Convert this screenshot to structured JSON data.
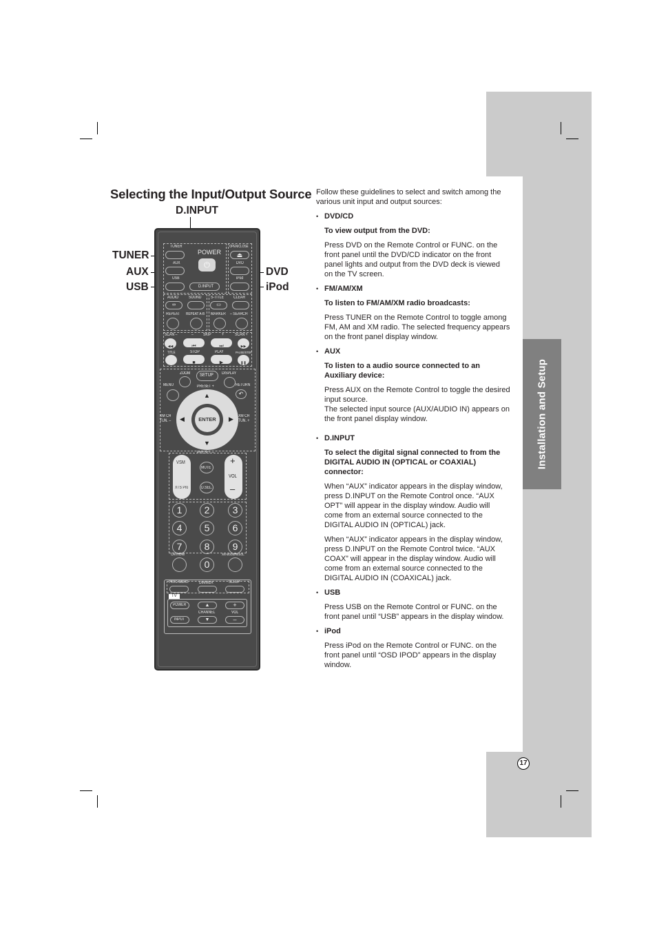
{
  "page": {
    "title": "Selecting the Input/Output Source",
    "side_tab": "Installation and Setup",
    "page_number": "17"
  },
  "callouts": {
    "dinput": "D.INPUT",
    "tuner": "TUNER",
    "aux": "AUX",
    "usb": "USB",
    "dvd": "DVD",
    "ipod": "iPod"
  },
  "remote": {
    "top": {
      "tuner": "TUNER",
      "aux": "AUX",
      "usb": "USB",
      "power": "POWER",
      "power_icon": "⏻",
      "dinput": "D.INPUT",
      "open_close": "OPEN/CLOSE",
      "eject_icon": "⏏",
      "dvd": "DVD",
      "ipod": "iPod"
    },
    "row2": {
      "audio": "AUDIO",
      "sound": "SOUND",
      "stitle": "S-TITLE",
      "clear": "CLEAR",
      "repeat": "REPEAT",
      "repeat_ab": "REPEAT A-B",
      "marker": "MARKER",
      "search": "– SEARCH"
    },
    "transport": {
      "scan_minus": "SCAN –",
      "skip_minus": "–",
      "skip": "SKIP",
      "skip_plus": "+",
      "scan_plus": "SCAN +",
      "rew_icon": "◀◀",
      "prev_icon": "⏮",
      "next_icon": "⏭",
      "ff_icon": "▶▶",
      "title": "TITLE",
      "stop": "STOP",
      "play": "PLAY",
      "pause": "PAUSE/STEP",
      "stop_icon": "■",
      "play_icon": "▶",
      "pause_icon": "❚❚"
    },
    "nav": {
      "zoom": "ZOOM",
      "setup": "SETUP",
      "display": "DISPLAY",
      "menu": "MENU",
      "return": "RETURN",
      "preset_plus": "PRESET +",
      "preset_minus": "PRESET –",
      "xm_left": "XM CH\nTUN. –",
      "xm_right": "XM CH\nTUN. +",
      "enter": "ENTER",
      "up": "▲",
      "down": "▼",
      "left": "◀",
      "right": "▶",
      "return_icon": "↶"
    },
    "volume": {
      "vsm": "VSM",
      "xts": "XTS Pro",
      "mute": "MUTE",
      "dsel": "D.SEL.",
      "plus": "+",
      "vol": "VOL",
      "minus": "–"
    },
    "numbers": [
      "1",
      "2",
      "3",
      "4",
      "5",
      "6",
      "7",
      "8",
      "9",
      "0"
    ],
    "num_labels": {
      "cat_hdmi": "CAT/HDMI",
      "xm_mode": "XM MODE/RESOL."
    },
    "bottom": {
      "prog_memo": "PROG./MEMO.",
      "dimmer": "DIMMER",
      "sleep": "SLEEP",
      "tv": "TV",
      "tv_power": "POWER",
      "tv_input": "INPUT",
      "channel": "CHANNEL",
      "vol": "VOL",
      "ch_up": "▲",
      "ch_down": "▼",
      "vol_plus": "+",
      "vol_minus": "–"
    }
  },
  "content": {
    "intro": "Follow these guidelines to select and switch among the various unit input and output sources:",
    "sections": [
      {
        "bullet": "DVD/CD",
        "subhead": "To view output from the DVD:",
        "paragraphs": [
          "Press DVD on the Remote Control or FUNC. on the front panel until the DVD/CD indicator on the front panel lights and output from the DVD deck is viewed on the TV screen."
        ]
      },
      {
        "bullet": "FM/AM/XM",
        "subhead": "To listen to FM/AM/XM radio broadcasts:",
        "paragraphs": [
          "Press TUNER on the Remote Control to toggle among FM, AM and XM radio. The selected frequency appears on the front panel display window."
        ]
      },
      {
        "bullet": "AUX",
        "subhead": "To listen to a audio source connected to an Auxiliary device:",
        "paragraphs": [
          "Press AUX on the Remote Control to toggle the desired input source.",
          "The selected input source (AUX/AUDIO IN) appears on the front panel display window."
        ]
      },
      {
        "bullet": "D.INPUT",
        "subhead": "To select the digital signal connected to from the DIGITAL AUDIO IN (OPTICAL or COAXIAL) connector:",
        "paragraphs": [
          "When “AUX” indicator appears in the display window, press D.INPUT on the Remote Control once. “AUX OPT” will appear in the display window. Audio will come from an external source connected to the DIGITAL AUDIO IN (OPTICAL) jack.",
          "When “AUX” indicator appears in the display window, press D.INPUT on the Remote Control twice. “AUX COAX” will appear in the display window. Audio will come from an external source connected to the DIGITAL AUDIO IN (COAXICAL) jack."
        ]
      },
      {
        "bullet": "USB",
        "paragraphs": [
          "Press USB on the Remote Control or FUNC. on the front panel until “USB” appears in the display window."
        ]
      },
      {
        "bullet": "iPod",
        "paragraphs": [
          "Press iPod on the Remote Control or FUNC. on the front panel until “OSD IPOD” appears in the display window."
        ]
      }
    ]
  }
}
